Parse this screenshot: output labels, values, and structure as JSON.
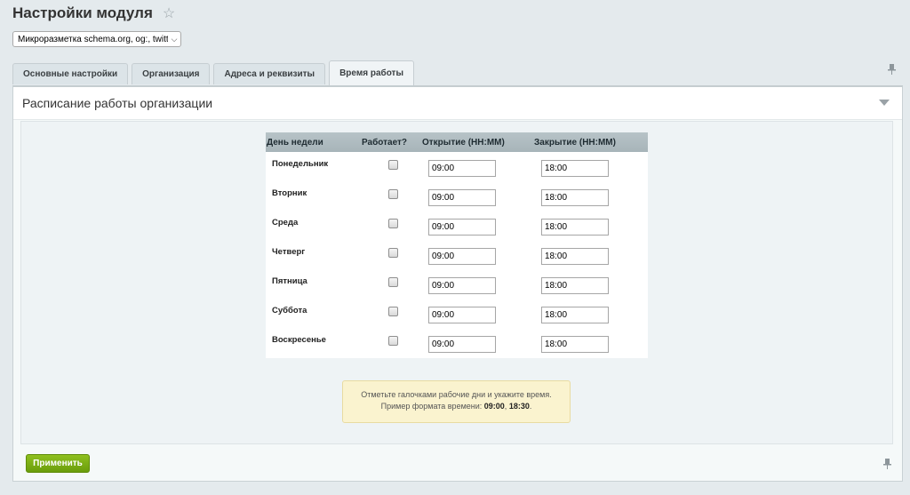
{
  "header": {
    "title": "Настройки модуля",
    "star_icon": "star-icon"
  },
  "module_select": {
    "value": "Микроразметка schema.org, og:, twitter:"
  },
  "tabs": [
    {
      "label": "Основные настройки",
      "active": false
    },
    {
      "label": "Организация",
      "active": false
    },
    {
      "label": "Адреса и реквизиты",
      "active": false
    },
    {
      "label": "Время работы",
      "active": true
    }
  ],
  "panel": {
    "title": "Расписание работы организации"
  },
  "schedule": {
    "columns": [
      "День недели",
      "Работает?",
      "Открытие (HH:MM)",
      "Закрытие (HH:MM)"
    ],
    "rows": [
      {
        "day": "Понедельник",
        "works": false,
        "open": "09:00",
        "close": "18:00"
      },
      {
        "day": "Вторник",
        "works": false,
        "open": "09:00",
        "close": "18:00"
      },
      {
        "day": "Среда",
        "works": false,
        "open": "09:00",
        "close": "18:00"
      },
      {
        "day": "Четверг",
        "works": false,
        "open": "09:00",
        "close": "18:00"
      },
      {
        "day": "Пятница",
        "works": false,
        "open": "09:00",
        "close": "18:00"
      },
      {
        "day": "Суббота",
        "works": false,
        "open": "09:00",
        "close": "18:00"
      },
      {
        "day": "Воскресенье",
        "works": false,
        "open": "09:00",
        "close": "18:00"
      }
    ]
  },
  "hint": {
    "line1": "Отметьте галочками рабочие дни и укажите время.",
    "line2_prefix": "Пример формата времени: ",
    "example1": "09:00",
    "separator": ", ",
    "example2": "18:30",
    "suffix": "."
  },
  "footer": {
    "apply_label": "Применить"
  },
  "colors": {
    "accent_green": "#7aad14",
    "table_header": "#aebbc0",
    "hint_background": "#faf3cf"
  }
}
